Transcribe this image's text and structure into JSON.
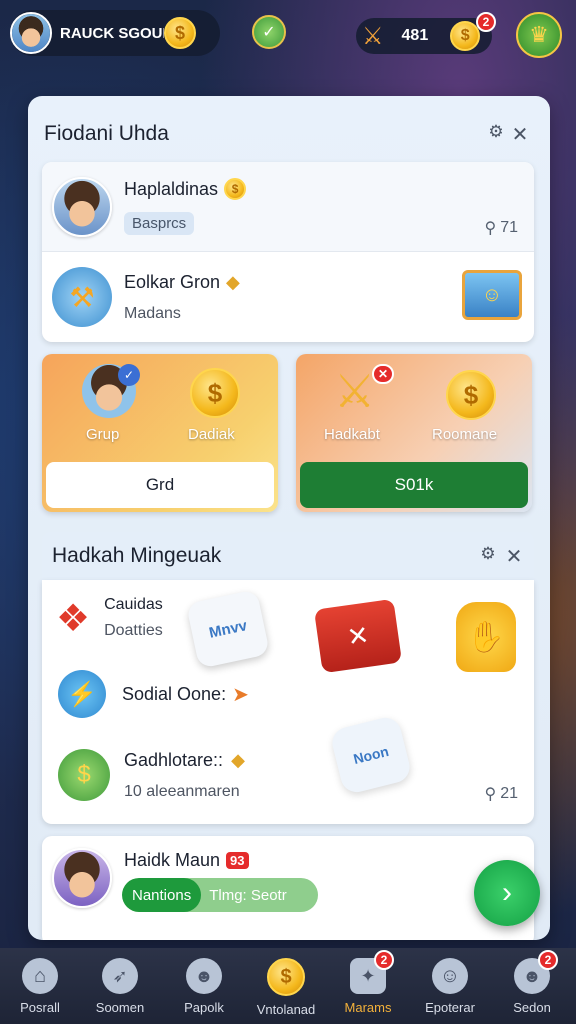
{
  "top_bar": {
    "player_name": "RAUCK SGOUP",
    "resource_value": "481",
    "resource_badge": "2"
  },
  "panel": {
    "title": "Fiodani Uhda",
    "friends": [
      {
        "name": "Haplaldinas",
        "tag": "Basprcs",
        "count": "71"
      },
      {
        "name": "Eolkar Gron",
        "sub": "Madans"
      }
    ],
    "tiles": [
      {
        "label_left": "Grup",
        "label_right": "Dadiak",
        "button": "Grd"
      },
      {
        "label_left": "Hadkabt",
        "label_right": "Roomane",
        "button": "S01k"
      }
    ]
  },
  "section": {
    "title": "Hadkah Mingeuak",
    "items": [
      {
        "title": "Cauidas",
        "sub": "Doatties"
      },
      {
        "title": "Sodial Oone:"
      },
      {
        "title": "Gadhlotare::",
        "sub": "10 aleeanmaren",
        "count": "21"
      }
    ],
    "sticker_text": "Mnvv",
    "sticker_text_2": "Noon"
  },
  "bottom_card": {
    "name": "Haidk Maun",
    "badge": "93",
    "pill_left": "Nantions",
    "pill_right": "Tlmg: Seotr"
  },
  "nav": {
    "items": [
      {
        "label": "Posrall"
      },
      {
        "label": "Soomen"
      },
      {
        "label": "Papolk"
      },
      {
        "label": "Vntolanad"
      },
      {
        "label": "Marams",
        "badge": "2"
      },
      {
        "label": "Epoterar"
      },
      {
        "label": "Sedon",
        "badge": "2"
      }
    ]
  }
}
